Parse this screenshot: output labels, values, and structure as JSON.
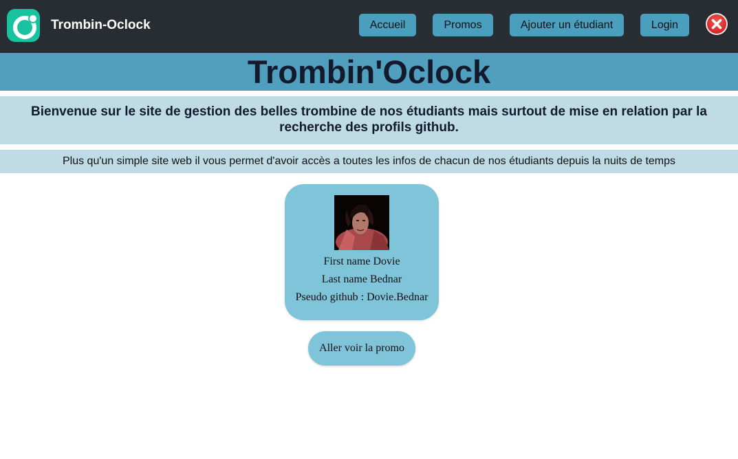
{
  "colors": {
    "navbar_bg": "#272d33",
    "accent_button": "#4a9fbf",
    "banner_bg": "#519fbf",
    "light_band": "#bedbe6",
    "card_bg": "#7fc4d8",
    "logo_green": "#19c3a0",
    "close_red": "#d42020"
  },
  "navbar": {
    "logo_icon": "oclock-logo-icon",
    "brand": "Trombin-Oclock",
    "links": [
      "Accueil",
      "Promos",
      "Ajouter un étudiant",
      "Login"
    ],
    "close_icon": "close-x-icon"
  },
  "banner": {
    "title": "Trombin'Oclock"
  },
  "intro": {
    "welcome": "Bienvenue sur le site de gestion des belles trombine de nos étudiants mais surtout de mise en relation par la recherche des profils github.",
    "subtitle": "Plus qu'un simple site web il vous permet d'avoir accès a toutes les infos de chacun de nos étudiants depuis la nuits de temps"
  },
  "student": {
    "avatar": "student-photo",
    "first_name": "First name Dovie",
    "last_name": "Last name Bednar",
    "github": "Pseudo github : Dovie.Bednar"
  },
  "actions": {
    "promo_button": "Aller voir la promo"
  }
}
